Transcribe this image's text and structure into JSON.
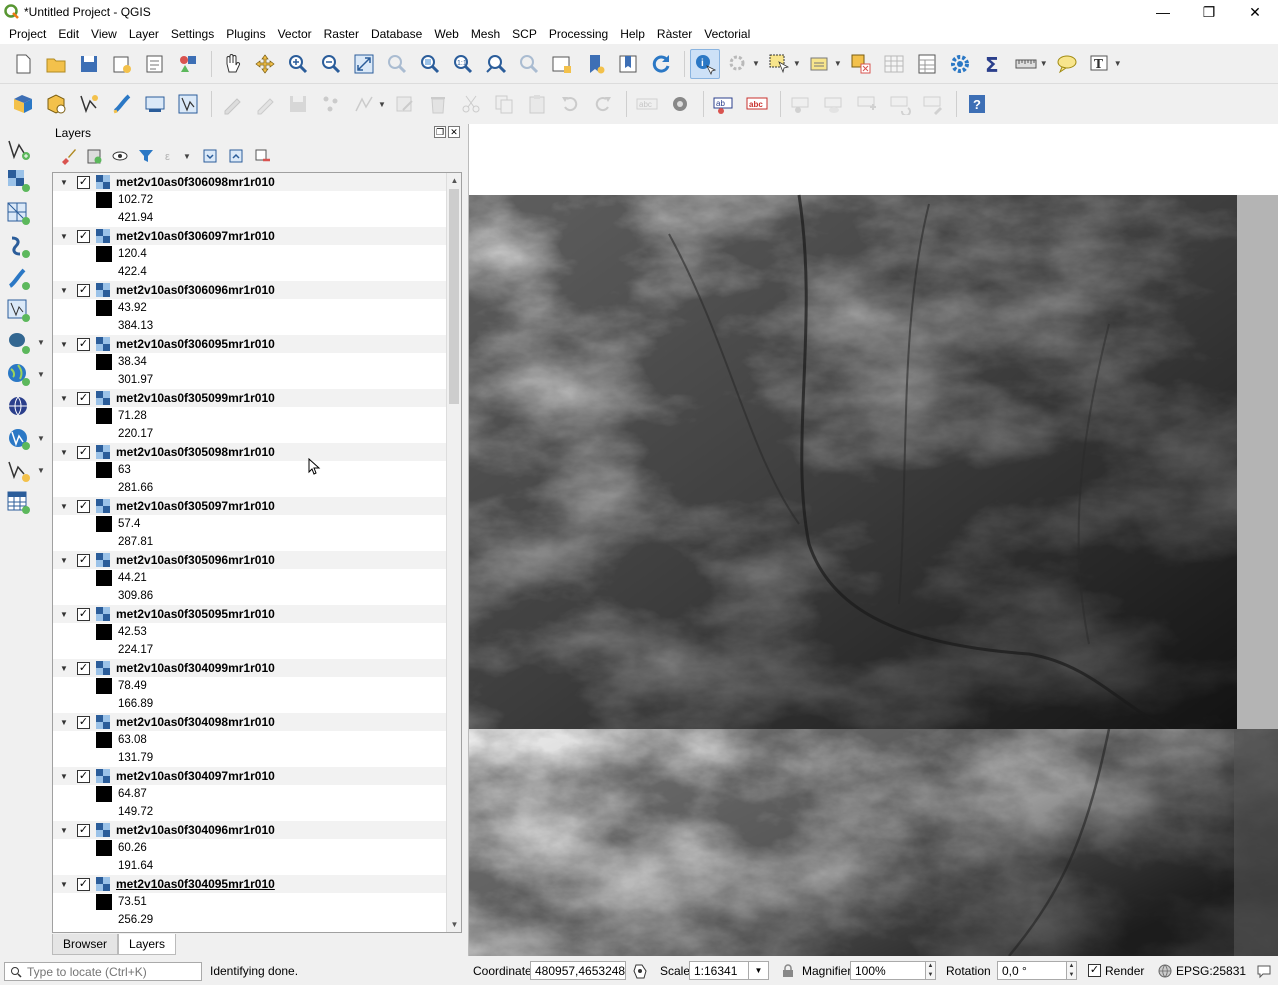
{
  "window": {
    "title": "*Untitled Project - QGIS",
    "controls": {
      "minimize": "—",
      "restore": "❐",
      "close": "✕"
    }
  },
  "menu": [
    "Project",
    "Edit",
    "View",
    "Layer",
    "Settings",
    "Plugins",
    "Vector",
    "Raster",
    "Database",
    "Web",
    "Mesh",
    "SCP",
    "Processing",
    "Help",
    "Ràster",
    "Vectorial"
  ],
  "layers_panel": {
    "title": "Layers",
    "tabs": {
      "browser": "Browser",
      "layers": "Layers"
    },
    "layers": [
      {
        "name": "met2v10as0f306098mr1r010",
        "min": "102.72",
        "max": "421.94"
      },
      {
        "name": "met2v10as0f306097mr1r010",
        "min": "120.4",
        "max": "422.4"
      },
      {
        "name": "met2v10as0f306096mr1r010",
        "min": "43.92",
        "max": "384.13"
      },
      {
        "name": "met2v10as0f306095mr1r010",
        "min": "38.34",
        "max": "301.97"
      },
      {
        "name": "met2v10as0f305099mr1r010",
        "min": "71.28",
        "max": "220.17"
      },
      {
        "name": "met2v10as0f305098mr1r010",
        "min": "63",
        "max": "281.66"
      },
      {
        "name": "met2v10as0f305097mr1r010",
        "min": "57.4",
        "max": "287.81"
      },
      {
        "name": "met2v10as0f305096mr1r010",
        "min": "44.21",
        "max": "309.86"
      },
      {
        "name": "met2v10as0f305095mr1r010",
        "min": "42.53",
        "max": "224.17"
      },
      {
        "name": "met2v10as0f304099mr1r010",
        "min": "78.49",
        "max": "166.89"
      },
      {
        "name": "met2v10as0f304098mr1r010",
        "min": "63.08",
        "max": "131.79"
      },
      {
        "name": "met2v10as0f304097mr1r010",
        "min": "64.87",
        "max": "149.72"
      },
      {
        "name": "met2v10as0f304096mr1r010",
        "min": "60.26",
        "max": "191.64"
      },
      {
        "name": "met2v10as0f304095mr1r010",
        "min": "73.51",
        "max": "256.29"
      }
    ]
  },
  "statusbar": {
    "locator_placeholder": "Type to locate (Ctrl+K)",
    "message": "Identifying done.",
    "coordinate_label": "Coordinate",
    "coordinate": "480957,4653248",
    "scale_label": "Scale",
    "scale": "1:16341",
    "magnifier_label": "Magnifier",
    "magnifier": "100%",
    "rotation_label": "Rotation",
    "rotation": "0,0 °",
    "render_label": "Render",
    "crs": "EPSG:25831"
  },
  "colors": {
    "accent": "#589632",
    "selection": "#cde1f7",
    "map_background": "#ffffff"
  }
}
